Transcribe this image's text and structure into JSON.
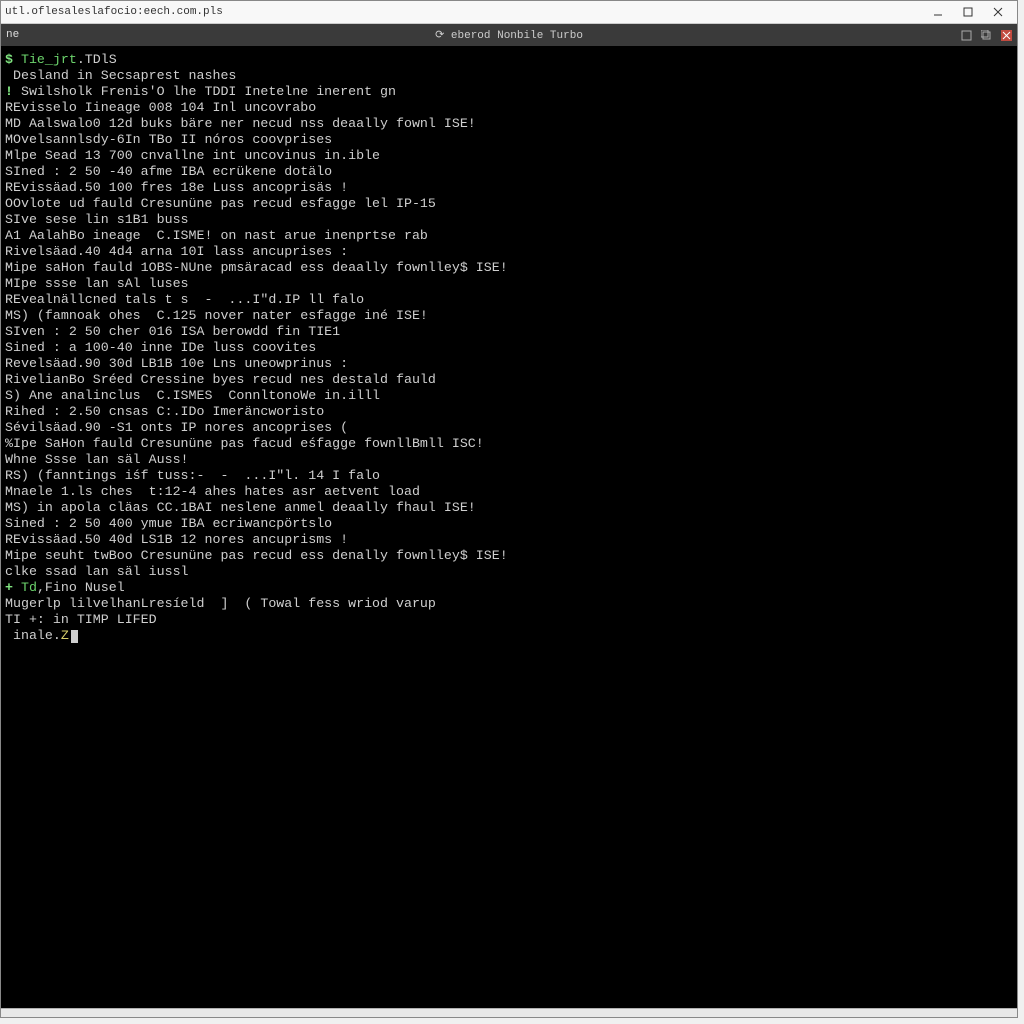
{
  "window": {
    "url": "utl.oflesaleslafocio:eech.com.pls"
  },
  "tab": {
    "left_stub": "ne",
    "center_title": "⟳ eberod Nonbile Turbo"
  },
  "terminal": {
    "lines": [
      {
        "segments": [
          {
            "cls": "gb",
            "text": "$ "
          },
          {
            "cls": "g",
            "text": "Tie_jrt"
          },
          {
            "cls": "w",
            "text": ".TDlS"
          }
        ]
      },
      {
        "segments": [
          {
            "cls": "w",
            "text": " Desland in Secsaprest nashes"
          }
        ]
      },
      {
        "segments": [
          {
            "cls": "gb",
            "text": "! "
          },
          {
            "cls": "w",
            "text": "Swilsholk Frenis'O lhe TDDI Inetelne inerent gn"
          }
        ]
      },
      {
        "segments": [
          {
            "cls": "w",
            "text": "REvisselo Iineage 008 104 Inl uncovrabo"
          }
        ]
      },
      {
        "segments": [
          {
            "cls": "w",
            "text": "MD Aalswalo0 12d buks bäre ner necud nss deaally fownl ISE!"
          }
        ]
      },
      {
        "segments": [
          {
            "cls": "w",
            "text": "MOvelsannlsdy-6In TBo II nóros coovprises"
          }
        ]
      },
      {
        "segments": [
          {
            "cls": "w",
            "text": "Mlpe Sead 13 700 cnvallne int uncovinus in.ible"
          }
        ]
      },
      {
        "segments": [
          {
            "cls": "w",
            "text": "SIned : 2 50 -40 afme IBA ecrükene dotälo"
          }
        ]
      },
      {
        "segments": [
          {
            "cls": "w",
            "text": "REvissäad.50 100 fres 18e Luss ancoprisäs !"
          }
        ]
      },
      {
        "segments": [
          {
            "cls": "w",
            "text": "OOvlote ud fauld Cresunüne pas recud esfagge lel IP-15"
          }
        ]
      },
      {
        "segments": [
          {
            "cls": "w",
            "text": "SIve sese lin s1B1 buss"
          }
        ]
      },
      {
        "segments": [
          {
            "cls": "w",
            "text": "A1 AalahBo ineage  C.ISME! on nast arue inenprtse rab"
          }
        ]
      },
      {
        "segments": [
          {
            "cls": "w",
            "text": "Rivelsäad.40 4d4 arna 10I lass ancuprises :"
          }
        ]
      },
      {
        "segments": [
          {
            "cls": "w",
            "text": "Mipe saHon fauld 1OBS-NUne pmsäracad ess deaally fownlley$ ISE!"
          }
        ]
      },
      {
        "segments": [
          {
            "cls": "w",
            "text": "MIpe ssse lan sAl luses"
          }
        ]
      },
      {
        "segments": [
          {
            "cls": "w",
            "text": "REvealnällcned tals t s  -  ...I\"d.IP ll falo"
          }
        ]
      },
      {
        "segments": [
          {
            "cls": "w",
            "text": "MS) (famnoak ohes  C.125 nover nater esfagge iné ISE!"
          }
        ]
      },
      {
        "segments": [
          {
            "cls": "w",
            "text": "SIven : 2 50 cher 016 ISA berowdd fin TIE1"
          }
        ]
      },
      {
        "segments": [
          {
            "cls": "w",
            "text": "Sined : a 100-40 inne IDe luss coovites"
          }
        ]
      },
      {
        "segments": [
          {
            "cls": "w",
            "text": "Revelsäad.90 30d LB1B 10e Lns uneowprinus :"
          }
        ]
      },
      {
        "segments": [
          {
            "cls": "w",
            "text": "RivelianBo Sréed Cressine byes recud nes destald fauld"
          }
        ]
      },
      {
        "segments": [
          {
            "cls": "w",
            "text": "S) Ane analinclus  C.ISMES  ConnltonoWe in.illl"
          }
        ]
      },
      {
        "segments": [
          {
            "cls": "w",
            "text": "Rihed : 2.50 cnsas C:.IDo Imeräncworisto"
          }
        ]
      },
      {
        "segments": [
          {
            "cls": "w",
            "text": "Sévilsäad.90 -S1 onts IP nores ancoprises ("
          }
        ]
      },
      {
        "segments": [
          {
            "cls": "w",
            "text": "%Ipe SaHon fauld Cresunüne pas facud eśfagge fownllBmll ISC!"
          }
        ]
      },
      {
        "segments": [
          {
            "cls": "w",
            "text": "Whne Ssse lan säl Auss!"
          }
        ]
      },
      {
        "segments": [
          {
            "cls": "w",
            "text": "RS) (fanntings iśf tuss:-  -  ...I\"l. 14 I falo"
          }
        ]
      },
      {
        "segments": [
          {
            "cls": "w",
            "text": "Mnaele 1.ls ches  t:12-4 ahes hates asr aetvent load"
          }
        ]
      },
      {
        "segments": [
          {
            "cls": "w",
            "text": "MS) in apola cläas CC.1BAI neslene anmel deaally fhaul ISE!"
          }
        ]
      },
      {
        "segments": [
          {
            "cls": "w",
            "text": "Sined : 2 50 400 ymue IBA ecriwancpörtslo"
          }
        ]
      },
      {
        "segments": [
          {
            "cls": "w",
            "text": "REvissäad.50 40d LS1B 12 nores ancuprisms !"
          }
        ]
      },
      {
        "segments": [
          {
            "cls": "w",
            "text": "Mipe seuht twBoo Cresunüne pas recud ess denally fownlley$ ISE!"
          }
        ]
      },
      {
        "segments": [
          {
            "cls": "w",
            "text": "clke ssad lan säl iussl"
          }
        ]
      },
      {
        "segments": [
          {
            "cls": "gb",
            "text": "+ "
          },
          {
            "cls": "g",
            "text": "Td"
          },
          {
            "cls": "w",
            "text": ",Fino Nusel"
          }
        ]
      },
      {
        "segments": [
          {
            "cls": "w",
            "text": "Mugerlp lilvelhanLresíeld  ]  ( Towal fess wriod varup"
          }
        ]
      },
      {
        "segments": [
          {
            "cls": "w",
            "text": "TI +: in TIMP LIFED"
          }
        ]
      },
      {
        "segments": [
          {
            "cls": "w",
            "text": " inale."
          },
          {
            "cls": "y",
            "text": "Z"
          }
        ]
      }
    ]
  }
}
